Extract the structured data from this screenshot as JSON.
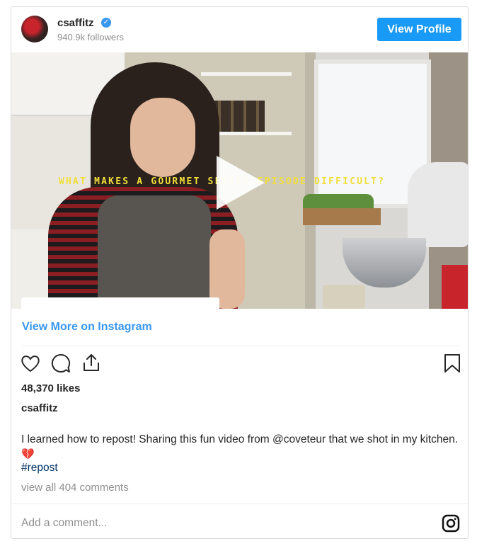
{
  "header": {
    "username": "csaffitz",
    "verified_mark": "✓",
    "followers": "940.9k followers",
    "view_profile": "View Profile"
  },
  "media": {
    "caption_overlay": "WHAT MAKES A GOURMET SERIES EPISODE DIFFICULT?"
  },
  "footer": {
    "view_more": "View More on Instagram",
    "likes": "48,370 likes",
    "author": "csaffitz",
    "caption_text": "I learned how to repost! Sharing this fun video from @coveteur that we shot in my kitchen.",
    "caption_emoji": "💔",
    "hashtag": "#repost",
    "view_comments": "view all 404 comments",
    "add_comment_placeholder": "Add a comment..."
  },
  "icons": [
    "heart-icon",
    "comment-icon",
    "share-icon",
    "bookmark-icon",
    "instagram-logo-icon",
    "play-icon",
    "verified-badge-icon"
  ],
  "colors": {
    "accent": "#1a9af7",
    "link": "#3897f0",
    "hashtag": "#003569",
    "muted": "#8e8e8e"
  }
}
